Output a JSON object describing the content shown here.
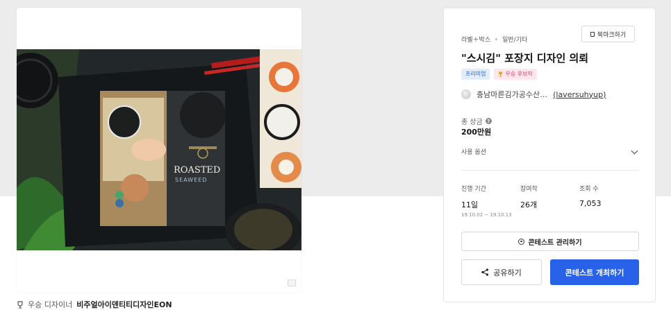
{
  "gallery": {
    "product_text": "ROASTED",
    "product_subtext": "SEAWEED"
  },
  "winner": {
    "label": "우승 디자이너",
    "name": "비주얼아이덴티티디자인EON"
  },
  "contest": {
    "category": "라벨＋박스",
    "subcategory": "일반/기타",
    "bookmark_label": "북마크하기",
    "title": "\"스시김\" 포장지 디자인 의뢰",
    "badges": {
      "premium": "프리미엄",
      "winner_candidate": "우승 후보작"
    },
    "client_name": "충남마른김가공수산…",
    "client_id": "(laversuhyup)",
    "prize_label": "총 상금",
    "prize_value": "200만원",
    "options_label": "사용 옵션",
    "stats": {
      "period_label": "진행 기간",
      "period_value": "11일",
      "period_range": "19.10.02 ~ 19.10.13",
      "entries_label": "참여작",
      "entries_value": "26개",
      "views_label": "조회 수",
      "views_value": "7,053"
    },
    "manage_label": "콘테스트 관리하기",
    "share_label": "공유하기",
    "host_label": "콘테스트 개최하기"
  },
  "colors": {
    "primary": "#2762e9",
    "premium_bg": "#e3ecfb",
    "winner_bg": "#fde6ec"
  }
}
